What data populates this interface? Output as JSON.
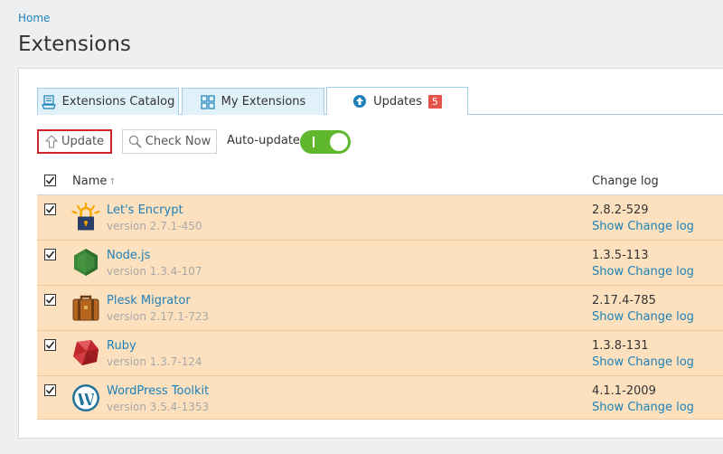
{
  "breadcrumb": {
    "home": "Home"
  },
  "page": {
    "title": "Extensions"
  },
  "tabs": [
    {
      "label": "Extensions Catalog",
      "icon": "catalog-icon"
    },
    {
      "label": "My Extensions",
      "icon": "grid-icon"
    },
    {
      "label": "Updates",
      "icon": "upload-circle-icon",
      "badge": "5"
    }
  ],
  "toolbar": {
    "update_label": "Update",
    "check_now_label": "Check Now",
    "auto_update_label": "Auto-update",
    "auto_update_on": true
  },
  "table": {
    "headers": {
      "name": "Name",
      "name_sort": "↑",
      "changelog": "Change log"
    },
    "rows": [
      {
        "name": "Let's Encrypt",
        "version": "version 2.7.1-450",
        "new_version": "2.8.2-529",
        "changelog_link": "Show Change log",
        "icon": "lets-encrypt-icon",
        "checked": true
      },
      {
        "name": "Node.js",
        "version": "version 1.3.4-107",
        "new_version": "1.3.5-113",
        "changelog_link": "Show Change log",
        "icon": "nodejs-icon",
        "checked": true
      },
      {
        "name": "Plesk Migrator",
        "version": "version 2.17.1-723",
        "new_version": "2.17.4-785",
        "changelog_link": "Show Change log",
        "icon": "suitcase-icon",
        "checked": true
      },
      {
        "name": "Ruby",
        "version": "version 1.3.7-124",
        "new_version": "1.3.8-131",
        "changelog_link": "Show Change log",
        "icon": "ruby-icon",
        "checked": true
      },
      {
        "name": "WordPress Toolkit",
        "version": "version 3.5.4-1353",
        "new_version": "4.1.1-2009",
        "changelog_link": "Show Change log",
        "icon": "wordpress-icon",
        "checked": true
      }
    ]
  },
  "colors": {
    "link": "#1d80b8",
    "row_highlight": "#fde1bf",
    "toggle_on": "#5eb72d",
    "badge": "#e5534b"
  }
}
